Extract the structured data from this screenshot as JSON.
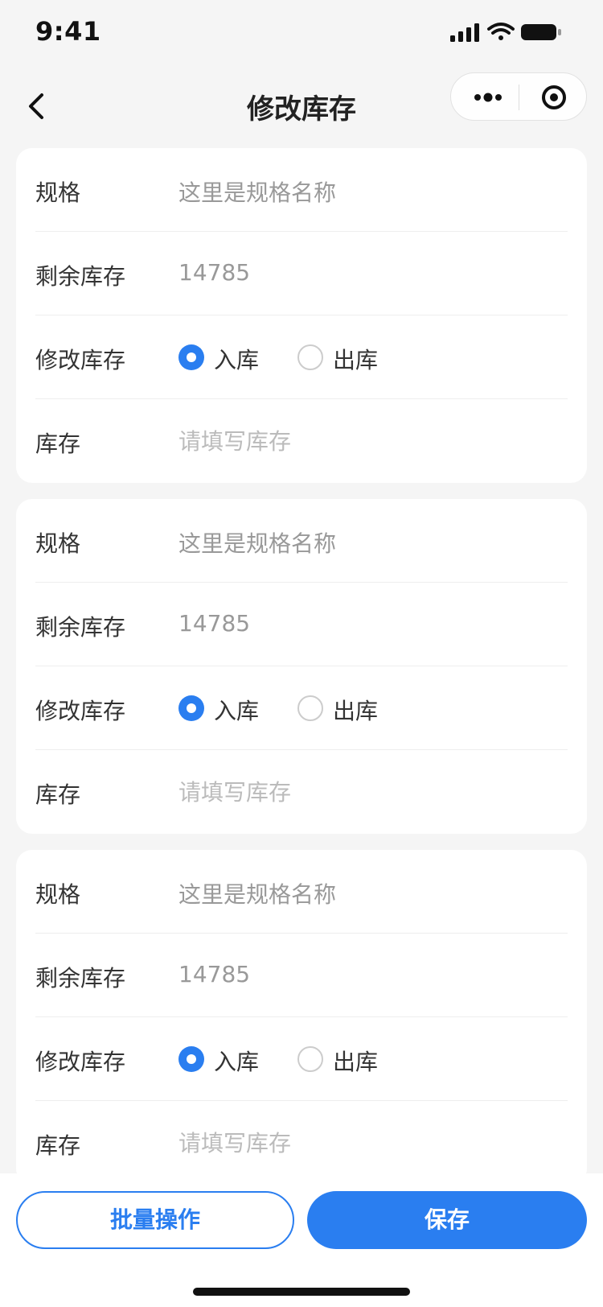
{
  "status_bar": {
    "time": "9:41"
  },
  "nav": {
    "title": "修改库存"
  },
  "labels": {
    "spec": "规格",
    "remaining": "剩余库存",
    "modify": "修改库存",
    "stock": "库存",
    "radio_in": "入库",
    "radio_out": "出库"
  },
  "items": [
    {
      "spec_name": "这里是规格名称",
      "remaining": "14785",
      "selected": "入库",
      "stock_placeholder": "请填写库存"
    },
    {
      "spec_name": "这里是规格名称",
      "remaining": "14785",
      "selected": "入库",
      "stock_placeholder": "请填写库存"
    },
    {
      "spec_name": "这里是规格名称",
      "remaining": "14785",
      "selected": "入库",
      "stock_placeholder": "请填写库存"
    }
  ],
  "footer": {
    "batch_label": "批量操作",
    "save_label": "保存"
  },
  "colors": {
    "accent": "#2a7ef0",
    "background": "#f5f5f5",
    "card": "#ffffff"
  }
}
